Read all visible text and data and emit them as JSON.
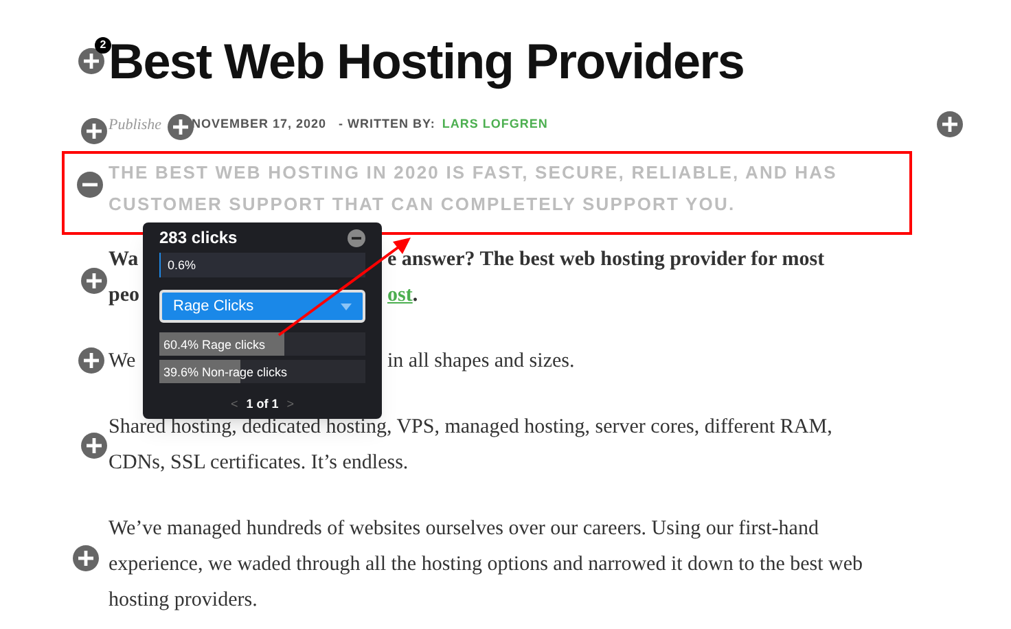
{
  "article": {
    "title": "Best Web Hosting Providers",
    "published_label": "Publishe",
    "date": "NOVEMBER 17, 2020",
    "written_by": "- WRITTEN BY:",
    "author": "LARS LOFGREN",
    "subtitle": "THE BEST WEB HOSTING IN 2020 IS FAST, SECURE, RELIABLE, AND HAS CUSTOMER SUPPORT THAT CAN COMPLETELY SUPPORT YOU.",
    "paragraphs": [
      {
        "kind": "split",
        "bold": true,
        "lines": [
          {
            "left": "Wa",
            "right": "e answer? The best web hosting provider for most"
          },
          {
            "left": "peo",
            "link": "ost",
            "after": "."
          }
        ]
      },
      {
        "kind": "split",
        "bold": false,
        "lines": [
          {
            "left": "We",
            "right": "in all shapes and sizes."
          }
        ]
      },
      {
        "kind": "plain",
        "bold": false,
        "text": "Shared hosting, dedicated hosting, VPS, managed hosting, server cores, different RAM, CDNs, SSL certificates. It’s endless."
      },
      {
        "kind": "plain",
        "bold": false,
        "text": "We’ve managed hundreds of websites ourselves over our careers. Using our first-hand experience, we waded through all the hosting options and narrowed it down to the best web hosting providers."
      }
    ]
  },
  "markers": [
    {
      "kind": "plus",
      "badge": "2"
    },
    {
      "kind": "plus"
    },
    {
      "kind": "plus"
    },
    {
      "kind": "plus"
    },
    {
      "kind": "minus"
    },
    {
      "kind": "plus"
    },
    {
      "kind": "plus"
    },
    {
      "kind": "plus"
    },
    {
      "kind": "plus"
    }
  ],
  "popup": {
    "title": "283 clicks",
    "share": {
      "label": "0.6%",
      "level": 0.006
    },
    "dropdown": {
      "value": "Rage Clicks"
    },
    "breakdown": [
      {
        "label": "60.4% Rage clicks",
        "level": 0.604
      },
      {
        "label": "39.6% Non-rage clicks",
        "level": 0.396
      }
    ],
    "pager": {
      "prev": "<",
      "text": "1 of 1",
      "next": ">"
    }
  }
}
